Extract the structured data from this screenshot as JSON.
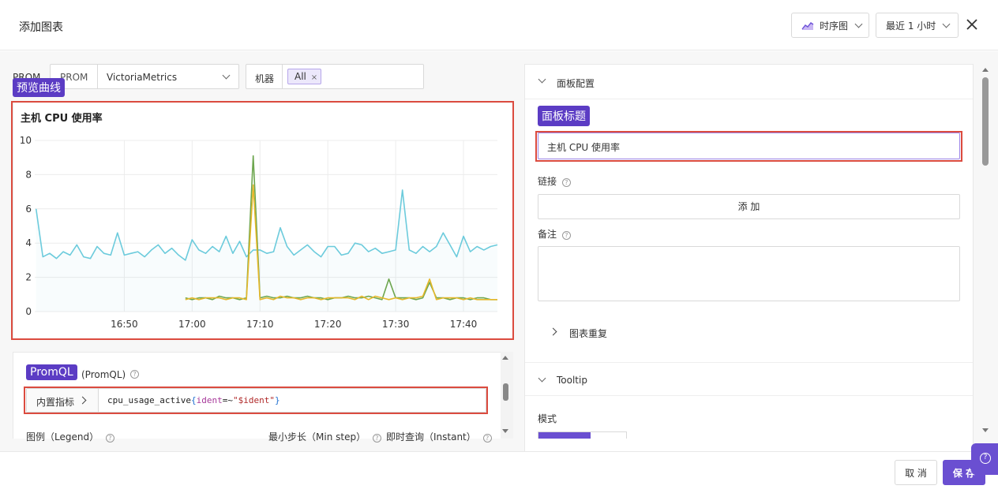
{
  "header": {
    "title": "添加图表",
    "chart_type_label": "时序图",
    "time_range_label": "最近 1 小时"
  },
  "filters": {
    "datasource_label_partial": "PROM",
    "datasource_type": "PROM",
    "datasource_value": "VictoriaMetrics",
    "machine_label": "机器",
    "machine_tag": "All"
  },
  "annotations": {
    "preview": "预览曲线",
    "panel_title": "面板标题",
    "promql": "PromQL"
  },
  "preview": {
    "chart_title": "主机 CPU 使用率"
  },
  "chart_data": {
    "type": "line",
    "title": "主机 CPU 使用率",
    "x_ticks": [
      "16:50",
      "17:00",
      "17:10",
      "17:20",
      "17:30",
      "17:40"
    ],
    "y_ticks": [
      0,
      2,
      4,
      6,
      8,
      10
    ],
    "ylim": [
      0,
      10
    ],
    "xlim_minutes": [
      "16:45",
      "17:45"
    ],
    "colors": [
      "#6ccbdc",
      "#6da64f",
      "#e6b82b"
    ],
    "series": [
      {
        "x": [
          "16:37",
          "16:38",
          "16:39",
          "16:40",
          "16:41",
          "16:42",
          "16:43",
          "16:44",
          "16:45",
          "16:46",
          "16:47",
          "16:48",
          "16:49",
          "16:50",
          "16:51",
          "16:52",
          "16:53",
          "16:54",
          "16:55",
          "16:56",
          "16:57",
          "16:58",
          "16:59",
          "17:00",
          "17:01",
          "17:02",
          "17:03",
          "17:04",
          "17:05",
          "17:06",
          "17:07",
          "17:08",
          "17:09",
          "17:10",
          "17:11",
          "17:12",
          "17:13",
          "17:14",
          "17:15",
          "17:16",
          "17:17",
          "17:18",
          "17:19",
          "17:20",
          "17:21",
          "17:22",
          "17:23",
          "17:24",
          "17:25",
          "17:26",
          "17:27",
          "17:28",
          "17:29",
          "17:30",
          "17:31",
          "17:32",
          "17:33",
          "17:34",
          "17:35",
          "17:36",
          "17:37",
          "17:38",
          "17:39",
          "17:40",
          "17:41",
          "17:42",
          "17:43",
          "17:44",
          "17:45"
        ],
        "values": [
          6.0,
          3.2,
          3.4,
          3.1,
          3.5,
          3.3,
          3.9,
          3.2,
          3.1,
          3.8,
          3.4,
          3.3,
          4.6,
          3.3,
          3.4,
          3.5,
          3.2,
          3.6,
          3.9,
          3.4,
          3.7,
          3.3,
          3.0,
          4.2,
          3.6,
          3.4,
          3.8,
          3.5,
          4.4,
          3.4,
          4.1,
          3.2,
          3.6,
          3.6,
          3.4,
          3.5,
          4.9,
          3.8,
          3.3,
          3.6,
          3.9,
          3.5,
          3.2,
          3.8,
          3.8,
          3.3,
          3.4,
          4.0,
          3.9,
          3.5,
          3.7,
          3.4,
          3.5,
          3.6,
          7.1,
          3.6,
          3.4,
          3.8,
          3.5,
          3.8,
          4.6,
          3.9,
          3.2,
          4.4,
          3.5,
          3.8,
          3.6,
          3.8,
          3.9
        ]
      },
      {
        "x": [
          "16:59",
          "17:00",
          "17:01",
          "17:02",
          "17:03",
          "17:04",
          "17:05",
          "17:06",
          "17:07",
          "17:08",
          "17:09",
          "17:10",
          "17:11",
          "17:12",
          "17:13",
          "17:14",
          "17:15",
          "17:16",
          "17:17",
          "17:18",
          "17:19",
          "17:20",
          "17:21",
          "17:22",
          "17:23",
          "17:24",
          "17:25",
          "17:26",
          "17:27",
          "17:28",
          "17:29",
          "17:30",
          "17:31",
          "17:32",
          "17:33",
          "17:34",
          "17:35",
          "17:36",
          "17:37",
          "17:38",
          "17:39",
          "17:40",
          "17:41",
          "17:42",
          "17:43",
          "17:44",
          "17:45"
        ],
        "values": [
          0.8,
          0.7,
          0.8,
          0.8,
          0.7,
          0.9,
          0.8,
          0.8,
          0.7,
          0.8,
          9.1,
          0.8,
          0.9,
          0.8,
          0.8,
          0.9,
          0.8,
          0.8,
          0.9,
          0.8,
          0.8,
          0.7,
          0.8,
          0.8,
          0.9,
          0.8,
          0.8,
          0.9,
          0.8,
          0.7,
          1.9,
          0.8,
          0.8,
          0.8,
          0.7,
          0.8,
          1.7,
          0.8,
          0.8,
          0.7,
          0.8,
          0.8,
          0.7,
          0.8,
          0.8,
          0.7,
          0.7
        ]
      },
      {
        "x": [
          "16:59",
          "17:00",
          "17:01",
          "17:02",
          "17:03",
          "17:04",
          "17:05",
          "17:06",
          "17:07",
          "17:08",
          "17:09",
          "17:10",
          "17:11",
          "17:12",
          "17:13",
          "17:14",
          "17:15",
          "17:16",
          "17:17",
          "17:18",
          "17:19",
          "17:20",
          "17:21",
          "17:22",
          "17:23",
          "17:24",
          "17:25",
          "17:26",
          "17:27",
          "17:28",
          "17:29",
          "17:30",
          "17:31",
          "17:32",
          "17:33",
          "17:34",
          "17:35",
          "17:36",
          "17:37",
          "17:38",
          "17:39",
          "17:40",
          "17:41",
          "17:42",
          "17:43",
          "17:44",
          "17:45"
        ],
        "values": [
          0.7,
          0.8,
          0.7,
          0.8,
          0.8,
          0.8,
          0.7,
          0.8,
          0.8,
          0.7,
          7.4,
          0.7,
          0.8,
          0.7,
          0.9,
          0.8,
          0.8,
          0.7,
          0.8,
          0.8,
          0.7,
          0.8,
          0.8,
          0.8,
          0.8,
          0.7,
          0.9,
          0.7,
          0.9,
          0.8,
          0.7,
          0.8,
          0.7,
          0.8,
          0.8,
          0.9,
          1.9,
          0.7,
          0.8,
          0.8,
          0.8,
          0.7,
          0.8,
          0.7,
          0.7,
          0.7,
          0.7
        ]
      }
    ]
  },
  "query": {
    "header_partial": "(PromQL)",
    "builtin_label": "内置指标",
    "expr_metric": "cpu_usage_active",
    "expr_open": "{",
    "expr_label": "ident",
    "expr_op": "=~",
    "expr_value": "\"$ident\"",
    "expr_close": "}",
    "legend_label": "图例（Legend）",
    "min_step_label": "最小步长（Min step）",
    "instant_label": "即时查询（Instant）"
  },
  "panel_config": {
    "section_label": "面板配置",
    "title_value": "主机 CPU 使用率",
    "link_label": "链接",
    "add_button": "添 加",
    "note_label": "备注",
    "repeat_label": "图表重复",
    "tooltip_label": "Tooltip",
    "mode_label": "模式"
  },
  "footer": {
    "cancel": "取 消",
    "save": "保 存"
  },
  "help": "?"
}
